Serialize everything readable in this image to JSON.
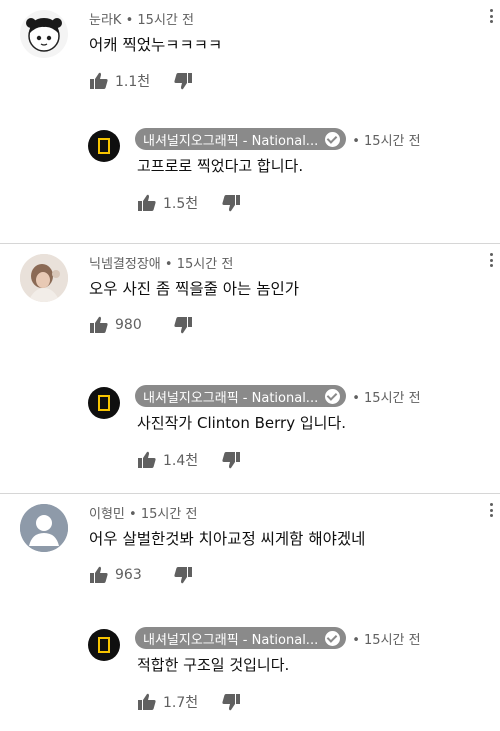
{
  "separator": "•",
  "threads": [
    {
      "author": "눈라K",
      "time": "15시간 전",
      "text": "어캐 찍었누ㅋㅋㅋㅋ",
      "likes": "1.1천",
      "avatar": "avatar-cartoon",
      "reply": {
        "author": "내셔널지오그래픽 - National...",
        "time": "15시간 전",
        "text": "고프로로 찍었다고 합니다.",
        "likes": "1.5천"
      }
    },
    {
      "author": "닉넴결정장애",
      "time": "15시간 전",
      "text": "오우 사진 좀 찍을줄 아는 놈인가",
      "likes": "980",
      "avatar": "avatar-photo",
      "reply": {
        "author": "내셔널지오그래픽 - National...",
        "time": "15시간 전",
        "text": "사진작가 Clinton Berry 입니다.",
        "likes": "1.4천"
      }
    },
    {
      "author": "이형민",
      "time": "15시간 전",
      "text": "어우 살벌한것봐 치아교정 씨게함 해야겠네",
      "likes": "963",
      "avatar": "avatar-default",
      "reply": {
        "author": "내셔널지오그래픽 - National...",
        "time": "15시간 전",
        "text": "적합한 구조일 것입니다.",
        "likes": "1.7천"
      }
    }
  ]
}
